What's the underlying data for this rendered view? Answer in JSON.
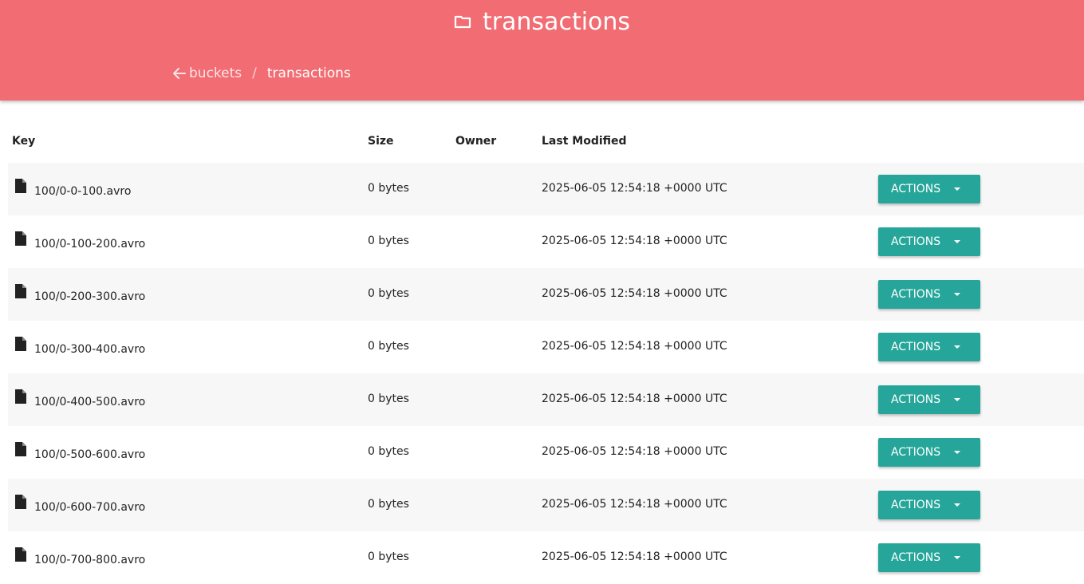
{
  "header": {
    "title": "transactions",
    "breadcrumb": {
      "back_label": "buckets",
      "separator": "/",
      "current": "transactions"
    },
    "background_color": "#f16d73"
  },
  "table": {
    "columns": {
      "key": "Key",
      "size": "Size",
      "owner": "Owner",
      "last_modified": "Last Modified"
    },
    "rows": [
      {
        "key": "100/0-0-100.avro",
        "size": "0 bytes",
        "owner": "",
        "last_modified": "2025-06-05 12:54:18 +0000 UTC",
        "action": "ACTIONS"
      },
      {
        "key": "100/0-100-200.avro",
        "size": "0 bytes",
        "owner": "",
        "last_modified": "2025-06-05 12:54:18 +0000 UTC",
        "action": "ACTIONS"
      },
      {
        "key": "100/0-200-300.avro",
        "size": "0 bytes",
        "owner": "",
        "last_modified": "2025-06-05 12:54:18 +0000 UTC",
        "action": "ACTIONS"
      },
      {
        "key": "100/0-300-400.avro",
        "size": "0 bytes",
        "owner": "",
        "last_modified": "2025-06-05 12:54:18 +0000 UTC",
        "action": "ACTIONS"
      },
      {
        "key": "100/0-400-500.avro",
        "size": "0 bytes",
        "owner": "",
        "last_modified": "2025-06-05 12:54:18 +0000 UTC",
        "action": "ACTIONS"
      },
      {
        "key": "100/0-500-600.avro",
        "size": "0 bytes",
        "owner": "",
        "last_modified": "2025-06-05 12:54:18 +0000 UTC",
        "action": "ACTIONS"
      },
      {
        "key": "100/0-600-700.avro",
        "size": "0 bytes",
        "owner": "",
        "last_modified": "2025-06-05 12:54:18 +0000 UTC",
        "action": "ACTIONS"
      },
      {
        "key": "100/0-700-800.avro",
        "size": "0 bytes",
        "owner": "",
        "last_modified": "2025-06-05 12:54:18 +0000 UTC",
        "action": "ACTIONS"
      }
    ],
    "action_button_color": "#26a69a"
  },
  "icons": {
    "title_icon": "folder-icon",
    "back_icon": "arrow-left-icon",
    "row_icon": "file-icon",
    "action_caret": "caret-down-icon"
  }
}
